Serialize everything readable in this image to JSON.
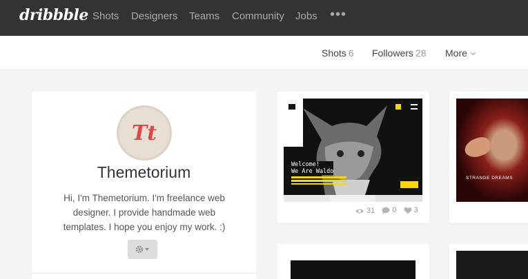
{
  "brand": {
    "logo": "dribbble"
  },
  "nav": {
    "items": [
      {
        "label": "Shots"
      },
      {
        "label": "Designers"
      },
      {
        "label": "Teams"
      },
      {
        "label": "Community"
      },
      {
        "label": "Jobs"
      }
    ],
    "more": "•••"
  },
  "subnav": {
    "shots": {
      "label": "Shots",
      "count": "6"
    },
    "followers": {
      "label": "Followers",
      "count": "28"
    },
    "more": {
      "label": "More"
    }
  },
  "profile": {
    "avatar_initials": "Tt",
    "name": "Themetorium",
    "bio": "Hi, I'm Themetorium. I'm freelance web designer. I provide handmade web templates. I hope you enjoy my work. :)",
    "settings_icon": "gear-icon"
  },
  "shots": [
    {
      "art": {
        "welcome_line1": "Welcome!",
        "welcome_line2": "We Are Waldo"
      },
      "views": "31",
      "comments": "0",
      "likes": "3"
    },
    {
      "art": {
        "title": "STRANGE DREAMS"
      }
    },
    {},
    {}
  ],
  "colors": {
    "nav_bg": "#333333",
    "accent_yellow": "#f5d90a",
    "avatar_red": "#d64a4a"
  }
}
